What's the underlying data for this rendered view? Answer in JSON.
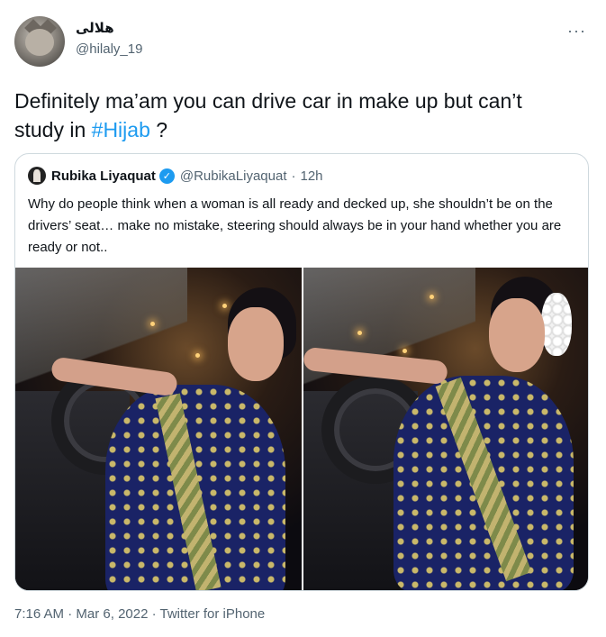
{
  "author": {
    "display_name": "هلالی",
    "handle": "@hilaly_19",
    "avatar_icon": "cat-avatar"
  },
  "menu": {
    "more_label": "···"
  },
  "tweet": {
    "text_before": "Definitely ma’am you can drive car in make up but can’t study in ",
    "hashtag": "#Hijab",
    "text_after": " ?"
  },
  "quoted": {
    "display_name": "Rubika Liyaquat",
    "verified_icon": "verified-badge-icon",
    "handle": "@RubikaLiyaquat",
    "separator": "·",
    "time": "12h",
    "text": "Why do people think when a woman is all ready and decked up, she shouldn’t be on the drivers’ seat… make no mistake, steering should always be in your hand whether you are ready or not..",
    "photos": [
      "photo-1",
      "photo-2"
    ]
  },
  "footer": {
    "time": "7:16 AM",
    "separator": "·",
    "date": "Mar 6, 2022",
    "source": "Twitter for iPhone"
  },
  "colors": {
    "link": "#1d9bf0",
    "secondary_text": "#536471",
    "border": "#cfd9de"
  }
}
